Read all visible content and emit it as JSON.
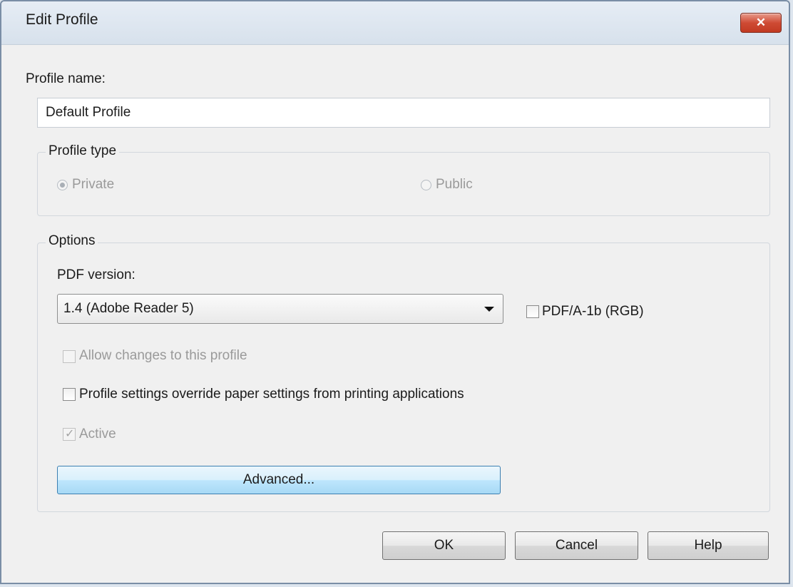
{
  "window": {
    "title": "Edit Profile",
    "close_glyph": "✕"
  },
  "profile_name": {
    "label": "Profile name:",
    "value": "Default Profile"
  },
  "profile_type": {
    "legend": "Profile type",
    "options": [
      {
        "label": "Private",
        "selected": true,
        "enabled": false
      },
      {
        "label": "Public",
        "selected": false,
        "enabled": false
      }
    ]
  },
  "options": {
    "legend": "Options",
    "pdf_version_label": "PDF version:",
    "pdf_version_value": "1.4 (Adobe Reader 5)",
    "pdfa_label": "PDF/A-1b (RGB)",
    "pdfa_checked": false,
    "allow_changes_label": "Allow changes to this profile",
    "allow_changes_checked": false,
    "override_label": "Profile settings override paper settings from printing applications",
    "override_checked": false,
    "active_label": "Active",
    "active_checked": true,
    "active_mark": "✓",
    "advanced_label": "Advanced..."
  },
  "buttons": {
    "ok": "OK",
    "cancel": "Cancel",
    "help": "Help"
  }
}
